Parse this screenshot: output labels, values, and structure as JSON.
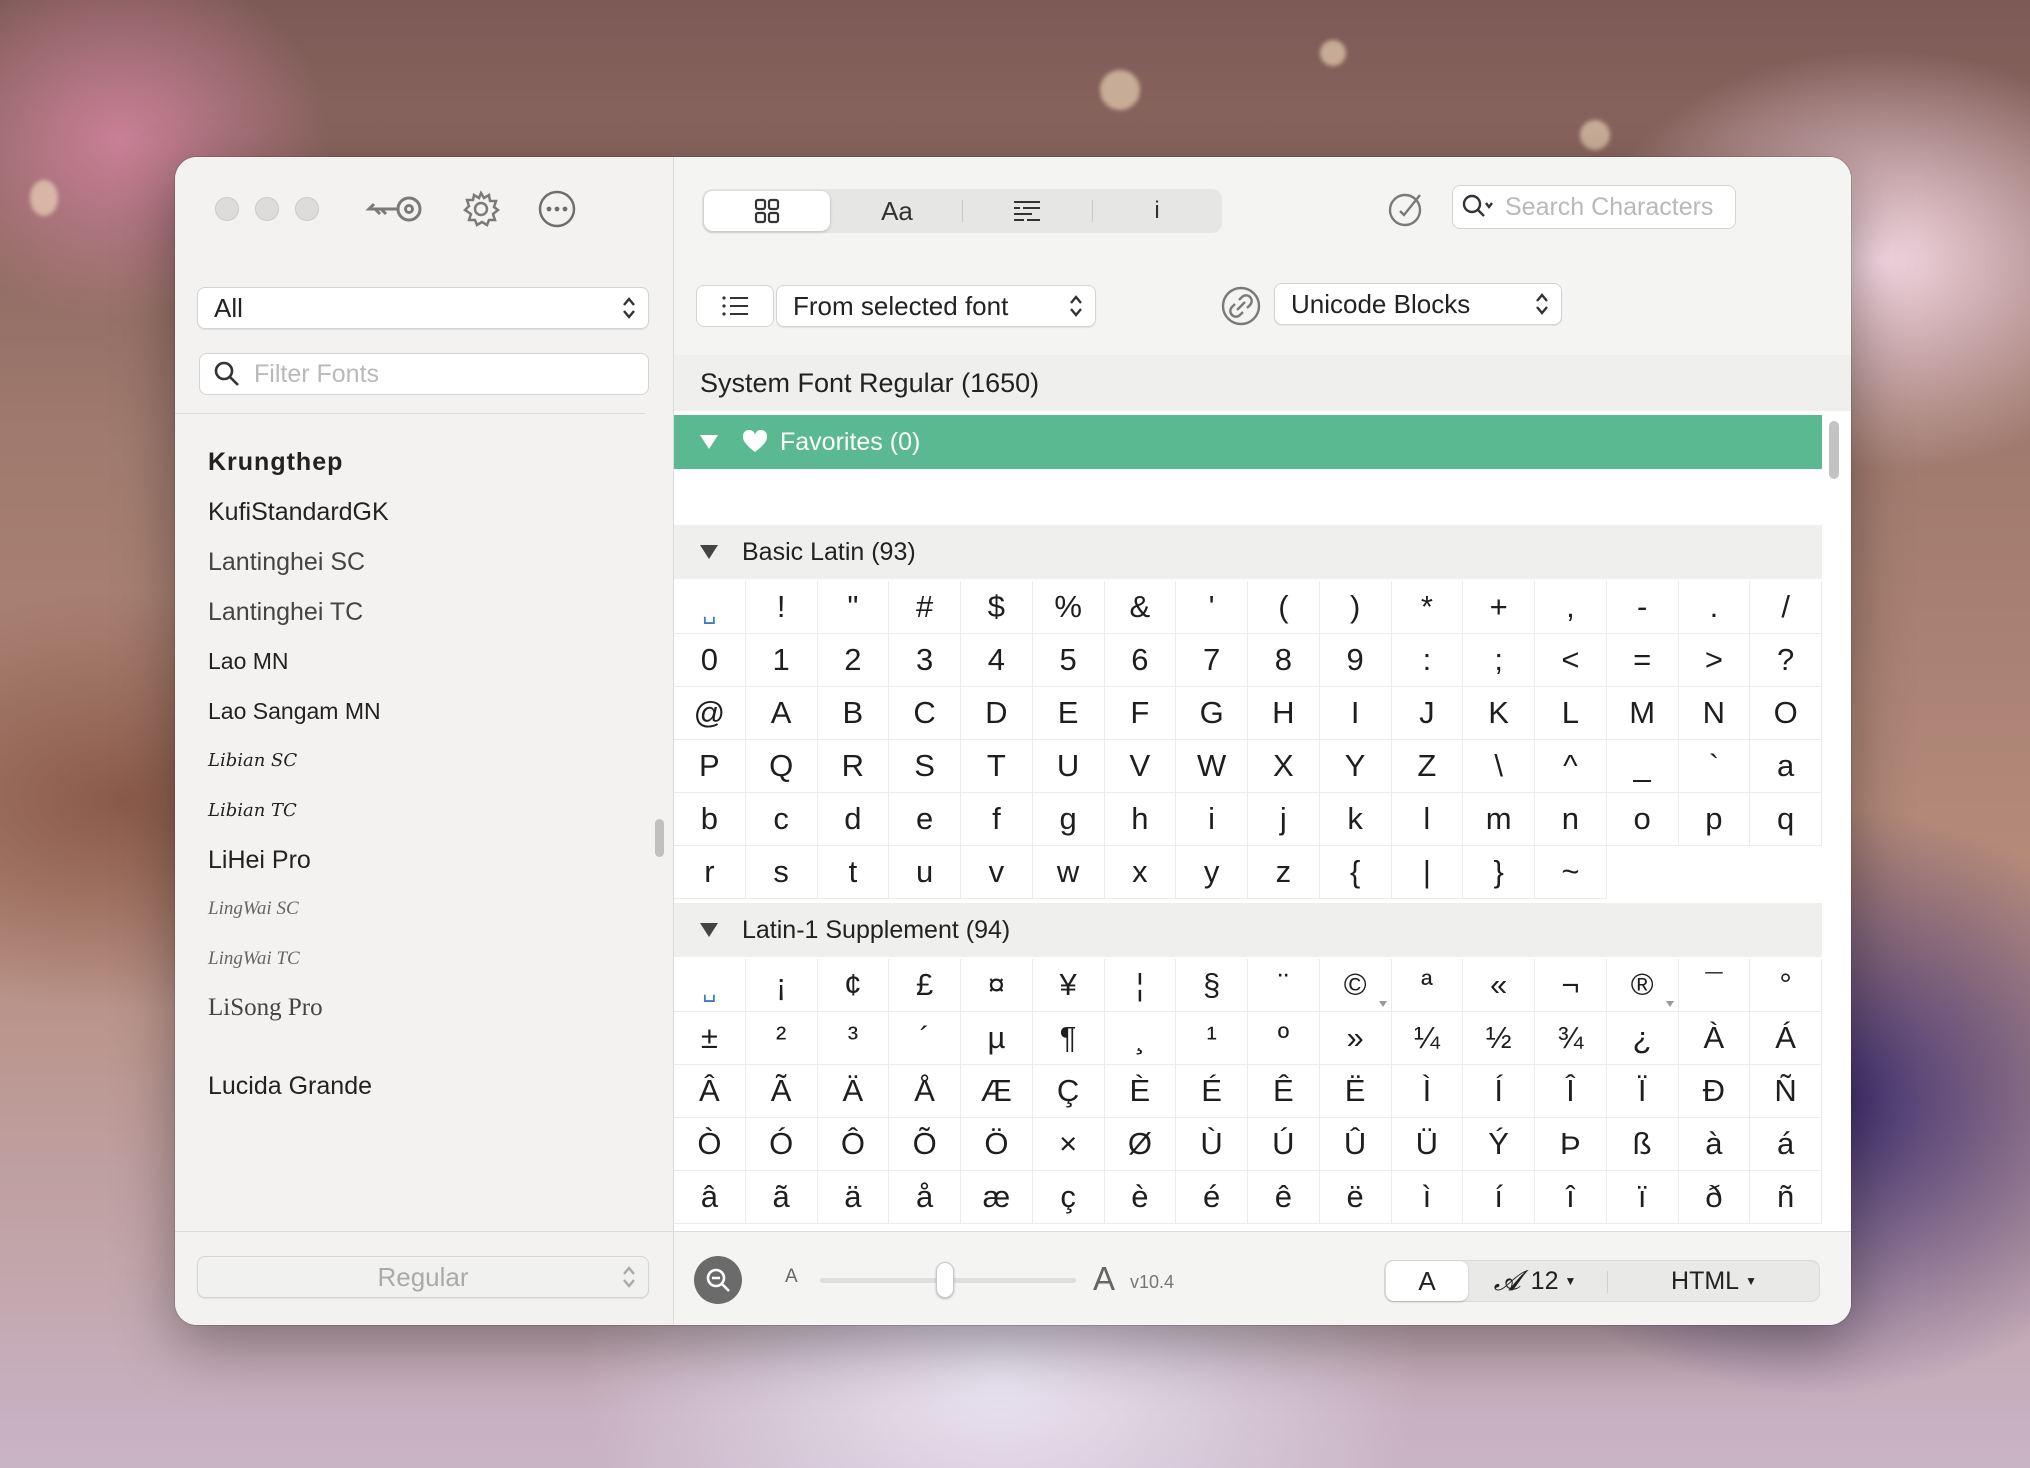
{
  "sidebar": {
    "category_select": "All",
    "filter_placeholder": "Filter Fonts",
    "fonts": [
      "Krungthep",
      "KufiStandardGK",
      "Lantinghei SC",
      "Lantinghei TC",
      "Lao MN",
      "Lao Sangam MN",
      "Libian SC",
      "Libian TC",
      "LiHei Pro",
      "LingWai SC",
      "LingWai TC",
      "LiSong Pro",
      "Lucida Grande"
    ],
    "style_select": "Regular"
  },
  "toolbar": {
    "tab_text": "Aa",
    "tab_info": "i",
    "search_placeholder": "Search Characters",
    "source_select": "From selected font",
    "blocks_select": "Unicode Blocks"
  },
  "font_title": "System Font Regular (1650)",
  "sections": {
    "favorites": "Favorites (0)",
    "basic_latin": "Basic Latin (93)",
    "latin1": "Latin-1 Supplement (94)"
  },
  "basic_latin_chars": [
    "␣",
    "!",
    "\"",
    "#",
    "$",
    "%",
    "&",
    "'",
    "(",
    ")",
    "*",
    "+",
    ",",
    "-",
    ".",
    "/",
    "0",
    "1",
    "2",
    "3",
    "4",
    "5",
    "6",
    "7",
    "8",
    "9",
    ":",
    ";",
    "<",
    "=",
    ">",
    "?",
    "@",
    "A",
    "B",
    "C",
    "D",
    "E",
    "F",
    "G",
    "H",
    "I",
    "J",
    "K",
    "L",
    "M",
    "N",
    "O",
    "P",
    "Q",
    "R",
    "S",
    "T",
    "U",
    "V",
    "W",
    "X",
    "Y",
    "Z",
    "\\",
    "^",
    "_",
    "`",
    "a",
    "b",
    "c",
    "d",
    "e",
    "f",
    "g",
    "h",
    "i",
    "j",
    "k",
    "l",
    "m",
    "n",
    "o",
    "p",
    "q",
    "r",
    "s",
    "t",
    "u",
    "v",
    "w",
    "x",
    "y",
    "z",
    "{",
    "|",
    "}",
    "~"
  ],
  "latin1_chars": [
    "␣",
    "¡",
    "¢",
    "£",
    "¤",
    "¥",
    "¦",
    "§",
    "¨",
    "©",
    "ª",
    "«",
    "¬",
    "®",
    "¯",
    "°",
    "±",
    "²",
    "³",
    "´",
    "µ",
    "¶",
    "¸",
    "¹",
    "º",
    "»",
    "¼",
    "½",
    "¾",
    "¿",
    "À",
    "Á",
    "Â",
    "Ã",
    "Ä",
    "Å",
    "Æ",
    "Ç",
    "È",
    "É",
    "Ê",
    "Ë",
    "Ì",
    "Í",
    "Î",
    "Ï",
    "Ð",
    "Ñ",
    "Ò",
    "Ó",
    "Ô",
    "Õ",
    "Ö",
    "×",
    "Ø",
    "Ù",
    "Ú",
    "Û",
    "Ü",
    "Ý",
    "Þ",
    "ß",
    "à",
    "á",
    "â",
    "ã",
    "ä",
    "å",
    "æ",
    "ç",
    "è",
    "é",
    "ê",
    "ë",
    "ì",
    "í",
    "î",
    "ï",
    "ð",
    "ñ"
  ],
  "bottom": {
    "zoom_small": "A",
    "zoom_large": "A",
    "zoom_level": 0.5,
    "version": "v10.4",
    "glyph_btn": "A",
    "font_size": "12",
    "format": "HTML"
  },
  "colors": {
    "favorites_bar": "#5bb991"
  }
}
